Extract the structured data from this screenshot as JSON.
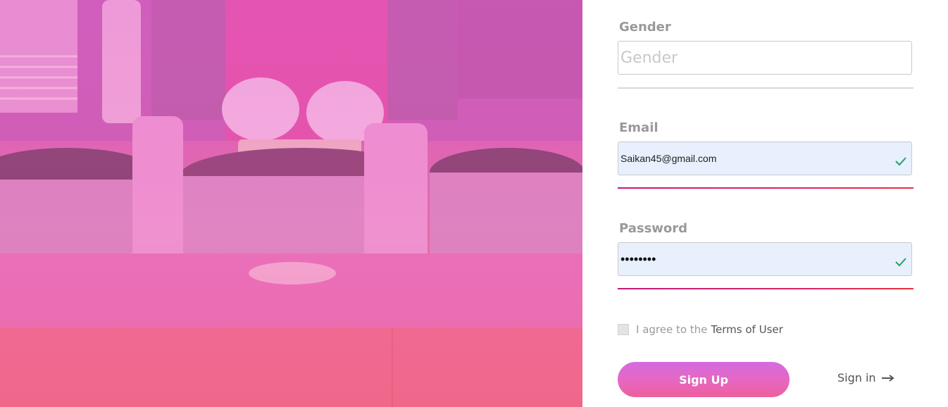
{
  "form": {
    "gender": {
      "label": "Gender",
      "placeholder": "Gender",
      "value": ""
    },
    "email": {
      "label": "Email",
      "value": "Saikan45@gmail.com",
      "valid_icon": "check-icon"
    },
    "password": {
      "label": "Password",
      "value": "••••••••",
      "valid_icon": "check-icon"
    },
    "terms": {
      "text": "I agree to the",
      "link": "Terms of User",
      "checked": false
    },
    "signup_label": "Sign Up",
    "signin_label": "Sign in",
    "signin_icon": "arrow-right-icon"
  },
  "colors": {
    "accent_gradient_start": "#d46be0",
    "accent_gradient_end": "#ee5f9c",
    "active_underline": "#e0245e",
    "valid_check": "#22a06b",
    "filled_input_bg": "#e8f0fd"
  },
  "hero": {
    "description_icon": "kitchen-photo"
  }
}
